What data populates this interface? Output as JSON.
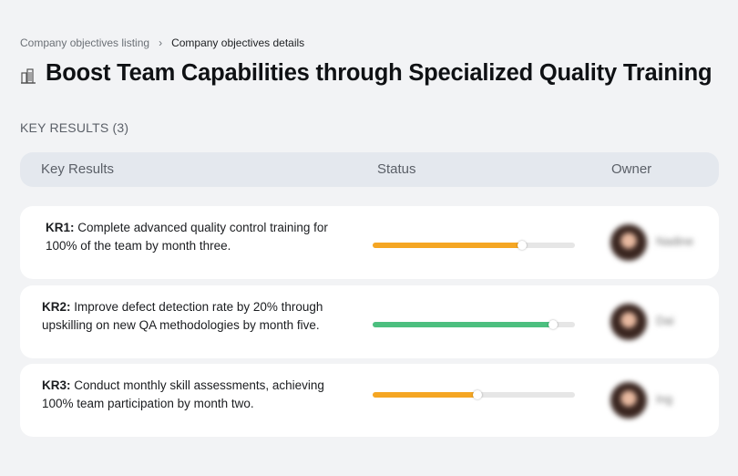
{
  "breadcrumb": {
    "parent": "Company objectives listing",
    "current": "Company objectives details",
    "separator_icon": "chevron-right-icon"
  },
  "objective": {
    "icon": "building-icon",
    "title": "Boost Team Capabilities through Specialized Quality Training"
  },
  "key_results_section": {
    "label": "KEY RESULTS (3)"
  },
  "table_header": {
    "key_results": "Key Results",
    "status": "Status",
    "owner": "Owner"
  },
  "key_results": [
    {
      "code": "KR1:",
      "text": " Complete advanced quality control training for 100% of the team by month three.",
      "progress_percent": 74,
      "progress_color": "#f5a623",
      "owner_name": "Nadine"
    },
    {
      "code": "KR2:",
      "text": " Improve defect detection rate by 20% through upskilling on new QA methodologies by month five.",
      "progress_percent": 89,
      "progress_color": "#4cbf7f",
      "owner_name": "Dai"
    },
    {
      "code": "KR3:",
      "text": " Conduct monthly skill assessments, achieving 100% team participation by month two.",
      "progress_percent": 52,
      "progress_color": "#f5a623",
      "owner_name": "Ing"
    }
  ]
}
